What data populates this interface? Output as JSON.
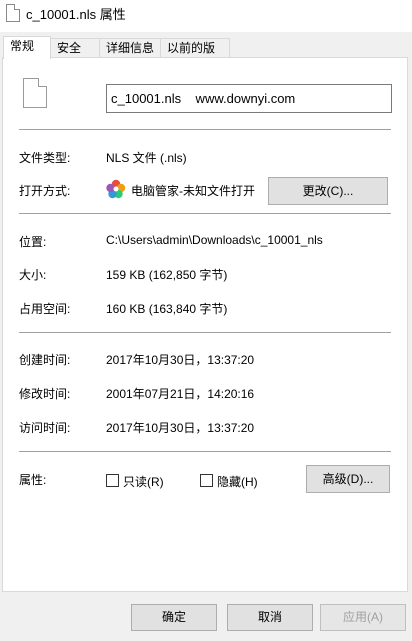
{
  "window": {
    "title": "c_10001.nls 属性",
    "icon": "file-icon"
  },
  "tabs": [
    {
      "label": "常规",
      "active": true
    },
    {
      "label": "安全",
      "active": false
    },
    {
      "label": "详细信息",
      "active": false
    },
    {
      "label": "以前的版本",
      "active": false
    }
  ],
  "general": {
    "file_icon": "blank-file-icon",
    "file_name": "c_10001.nls    www.downyi.com",
    "type_label": "文件类型:",
    "type_value": "NLS 文件 (.nls)",
    "opens_with_label": "打开方式:",
    "opens_with_app": "电脑管家-未知文件打开",
    "opens_with_icon": "pinwheel-icon",
    "change_button": "更改(C)...",
    "location_label": "位置:",
    "location_value": "C:\\Users\\admin\\Downloads\\c_10001_nls",
    "size_label": "大小:",
    "size_value": "159 KB (162,850 字节)",
    "size_on_disk_label": "占用空间:",
    "size_on_disk_value": "160 KB (163,840 字节)",
    "created_label": "创建时间:",
    "created_value": "2017年10月30日，13:37:20",
    "modified_label": "修改时间:",
    "modified_value": "2001年07月21日，14:20:16",
    "accessed_label": "访问时间:",
    "accessed_value": "2017年10月30日，13:37:20",
    "attributes_label": "属性:",
    "readonly_label": "只读(R)",
    "readonly_checked": false,
    "hidden_label": "隐藏(H)",
    "hidden_checked": false,
    "advanced_button": "高级(D)..."
  },
  "footer": {
    "ok_button": "确定",
    "cancel_button": "取消",
    "apply_button": "应用(A)"
  },
  "colors": {
    "window_bg": "#f0f0f0",
    "panel_bg": "#ffffff",
    "separator": "#a0a0a0",
    "button_bg": "#e1e1e1",
    "disabled_text": "#a0a0a0"
  }
}
